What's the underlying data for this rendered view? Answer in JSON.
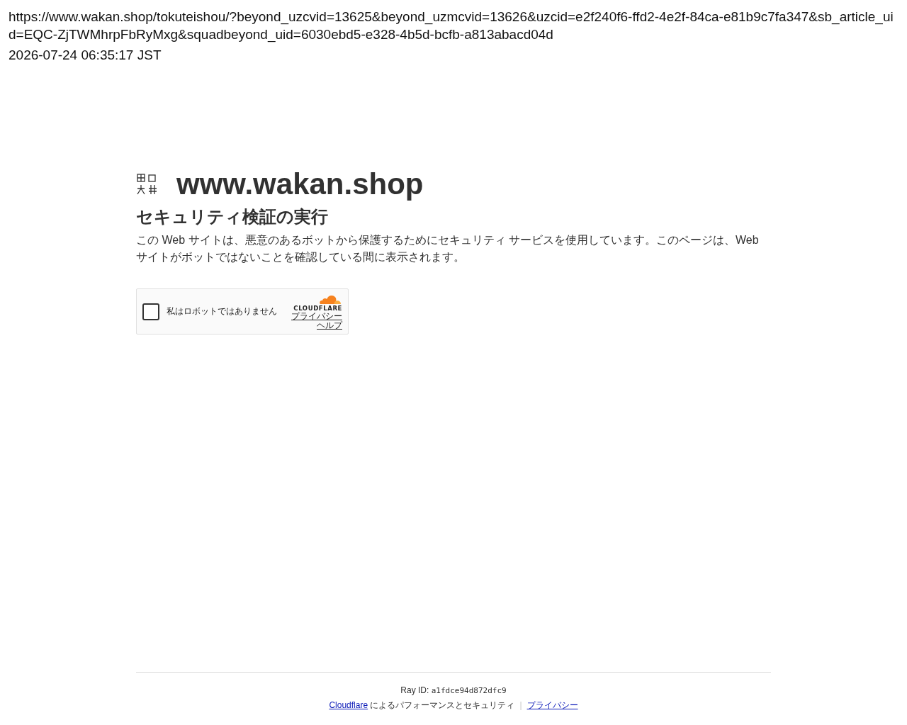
{
  "capture": {
    "url": "https://www.wakan.shop/tokuteishou/?beyond_uzcvid=13625&beyond_uzmcvid=13626&uzcid=e2f240f6-ffd2-4e2f-84ca-e81b9c7fa347&sb_article_uid=EQC-ZjTWMhrpFbRyMxg&squadbeyond_uid=6030ebd5-e328-4b5d-bcfb-a813abacd04d",
    "timestamp": "2026-07-24 06:35:17 JST"
  },
  "site": {
    "name": "www.wakan.shop"
  },
  "heading": "セキュリティ検証の実行",
  "description": "この Web サイトは、悪意のあるボットから保護するためにセキュリティ サービスを使用しています。このページは、Web サイトがボットではないことを確認している間に表示されます。",
  "challenge": {
    "checkbox": {
      "label": "私はロボットではありません",
      "checked": false
    },
    "brand": "CLOUDFLARE",
    "links": [
      "プライバシー",
      "ヘルプ"
    ]
  },
  "footer": {
    "ray_id_label": "Ray ID:",
    "ray_id": "a1fdce94d872dfc9",
    "performance_link": "Cloudflare",
    "performance_text": "によるパフォーマンスとセキュリティ",
    "separator": "|",
    "privacy_link": "プライバシー"
  }
}
